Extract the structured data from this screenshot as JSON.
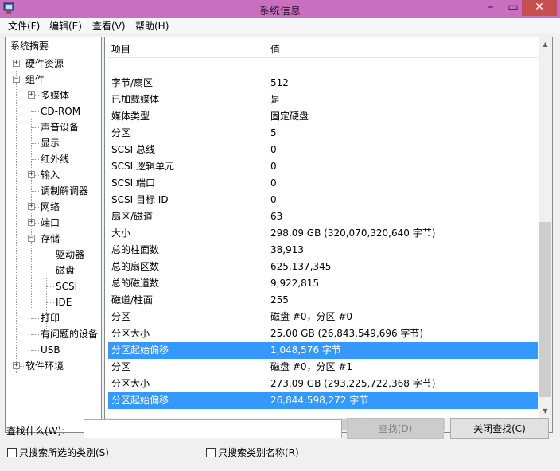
{
  "window": {
    "title": "系统信息",
    "close_glyph": "✕",
    "min_glyph": "–",
    "max_glyph": "▭"
  },
  "menu": [
    "文件(F)",
    "编辑(E)",
    "查看(V)",
    "帮助(H)"
  ],
  "tree": [
    {
      "label": "系统摘要"
    },
    {
      "label": "硬件资源",
      "expander": "+"
    },
    {
      "label": "组件",
      "expander": "−"
    },
    {
      "label": "多媒体",
      "expander": "+"
    },
    {
      "label": "CD-ROM"
    },
    {
      "label": "声音设备"
    },
    {
      "label": "显示"
    },
    {
      "label": "红外线"
    },
    {
      "label": "输入",
      "expander": "+"
    },
    {
      "label": "调制解调器"
    },
    {
      "label": "网络",
      "expander": "+"
    },
    {
      "label": "端口",
      "expander": "+"
    },
    {
      "label": "存储",
      "expander": "−"
    },
    {
      "label": "驱动器"
    },
    {
      "label": "磁盘"
    },
    {
      "label": "SCSI"
    },
    {
      "label": "IDE"
    },
    {
      "label": "打印"
    },
    {
      "label": "有问题的设备"
    },
    {
      "label": "USB"
    },
    {
      "label": "软件环境",
      "expander": "+"
    }
  ],
  "table": {
    "headers": [
      "项目",
      "值"
    ],
    "rows": [
      {
        "item": "字节/扇区",
        "value": "512"
      },
      {
        "item": "已加载媒体",
        "value": "是"
      },
      {
        "item": "媒体类型",
        "value": "固定硬盘"
      },
      {
        "item": "分区",
        "value": "5"
      },
      {
        "item": "SCSI 总线",
        "value": "0"
      },
      {
        "item": "SCSI 逻辑单元",
        "value": "0"
      },
      {
        "item": "SCSI 端口",
        "value": "0"
      },
      {
        "item": "SCSI 目标 ID",
        "value": "0"
      },
      {
        "item": "扇区/磁道",
        "value": "63"
      },
      {
        "item": "大小",
        "value": "298.09 GB (320,070,320,640 字节)"
      },
      {
        "item": "总的柱面数",
        "value": "38,913"
      },
      {
        "item": "总的扇区数",
        "value": "625,137,345"
      },
      {
        "item": "总的磁道数",
        "value": "9,922,815"
      },
      {
        "item": "磁道/柱面",
        "value": "255"
      },
      {
        "item": "分区",
        "value": "磁盘 #0，分区 #0"
      },
      {
        "item": "分区大小",
        "value": "25.00 GB (26,843,549,696 字节)"
      },
      {
        "item": "分区起始偏移",
        "value": "1,048,576 字节",
        "selected": true
      },
      {
        "item": "分区",
        "value": "磁盘 #0，分区 #1"
      },
      {
        "item": "分区大小",
        "value": "273.09 GB (293,225,722,368 字节)"
      },
      {
        "item": "分区起始偏移",
        "value": "26,844,598,272 字节",
        "selected": true
      }
    ]
  },
  "find": {
    "label": "查找什么(W):",
    "value": "",
    "find_button": "查找(D)",
    "close_button": "关闭查找(C)",
    "option_selected_category": "只搜索所选的类别(S)",
    "option_category_names": "只搜索类别名称(R)"
  },
  "colors": {
    "titlebar": "#c86fbf",
    "selection": "#3399ff",
    "close_button": "#c7504f"
  },
  "icons": [
    "system-info-icon",
    "minimize-icon",
    "maximize-icon",
    "close-icon",
    "scroll-up-icon",
    "scroll-down-icon",
    "scroll-left-icon",
    "scroll-right-icon"
  ]
}
